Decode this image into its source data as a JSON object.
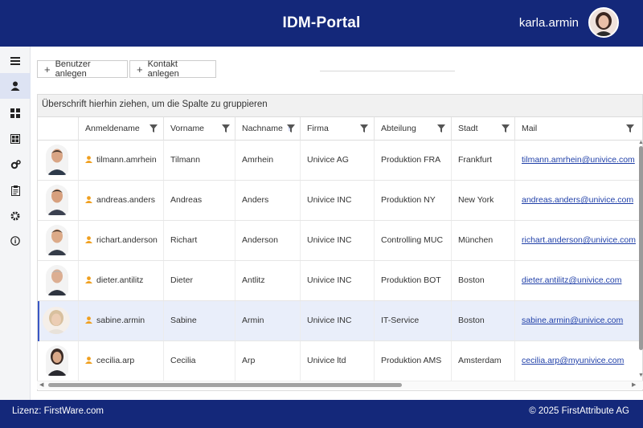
{
  "header": {
    "title": "IDM-Portal",
    "username": "karla.armin"
  },
  "sidebar": {
    "items": [
      {
        "icon": "menu-icon"
      },
      {
        "icon": "user-icon",
        "active": true
      },
      {
        "icon": "dashboard-icon"
      },
      {
        "icon": "groups-icon"
      },
      {
        "icon": "settings-gears-icon"
      },
      {
        "icon": "clipboard-icon"
      },
      {
        "icon": "gear-icon"
      },
      {
        "icon": "info-icon"
      }
    ]
  },
  "toolbar": {
    "create_user": "Benutzer anlegen",
    "create_contact": "Kontakt anlegen"
  },
  "grid": {
    "group_hint": "Überschrift hierhin ziehen, um die Spalte zu gruppieren",
    "columns": [
      "Anmeldename",
      "Vorname",
      "Nachname",
      "Firma",
      "Abteilung",
      "Stadt",
      "Mail"
    ],
    "sorted_column": "Nachname",
    "sort_direction": "ascending",
    "rows": [
      {
        "login": "tilmann.amrhein",
        "first": "Tilmann",
        "last": "Amrhein",
        "company": "Univice AG",
        "dept": "Produktion FRA",
        "city": "Frankfurt",
        "mail": "tilmann.amrhein@univice.com"
      },
      {
        "login": "andreas.anders",
        "first": "Andreas",
        "last": "Anders",
        "company": "Univice INC",
        "dept": "Produktion NY",
        "city": "New York",
        "mail": "andreas.anders@univice.com"
      },
      {
        "login": "richart.anderson",
        "first": "Richart",
        "last": "Anderson",
        "company": "Univice INC",
        "dept": "Controlling MUC",
        "city": "München",
        "mail": "richart.anderson@univice.com"
      },
      {
        "login": "dieter.antilitz",
        "first": "Dieter",
        "last": "Antlitz",
        "company": "Univice INC",
        "dept": "Produktion BOT",
        "city": "Boston",
        "mail": "dieter.antilitz@univice.com"
      },
      {
        "login": "sabine.armin",
        "first": "Sabine",
        "last": "Armin",
        "company": "Univice INC",
        "dept": "IT-Service",
        "city": "Boston",
        "mail": "sabine.armin@univice.com",
        "selected": true
      },
      {
        "login": "cecilia.arp",
        "first": "Cecilia",
        "last": "Arp",
        "company": "Univice ltd",
        "dept": "Produktion AMS",
        "city": "Amsterdam",
        "mail": "cecilia.arp@myunivice.com"
      }
    ]
  },
  "footer": {
    "license": "Lizenz: FirstWare.com",
    "copyright": "© 2025 FirstAttribute AG"
  },
  "colors": {
    "brand": "#14287a",
    "selection": "#e9eefa",
    "user_icon": "#f0a020",
    "link": "#1f3fa8"
  }
}
